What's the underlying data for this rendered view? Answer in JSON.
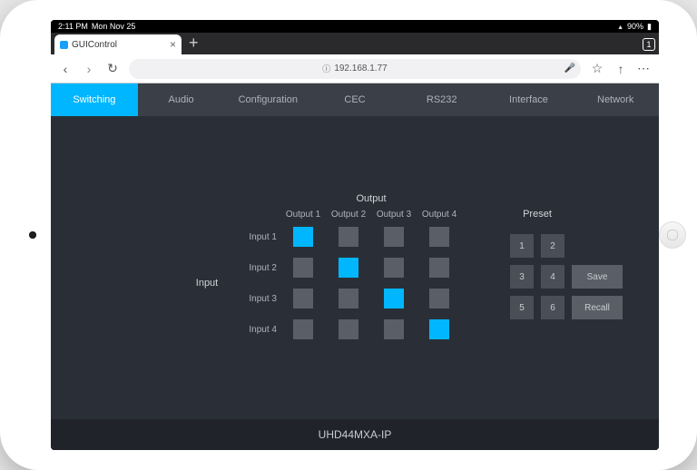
{
  "status": {
    "time": "2:11 PM",
    "date": "Mon Nov 25",
    "battery": "90%"
  },
  "browser": {
    "tab_title": "GUIControl",
    "tab_count": "1",
    "url": "192.168.1.77"
  },
  "nav": {
    "items": [
      "Switching",
      "Audio",
      "Configuration",
      "CEC",
      "RS232",
      "Interface",
      "Network"
    ],
    "active": 0
  },
  "matrix": {
    "output_title": "Output",
    "input_title": "Input",
    "outputs": [
      "Output 1",
      "Output 2",
      "Output 3",
      "Output 4"
    ],
    "inputs": [
      "Input 1",
      "Input 2",
      "Input 3",
      "Input 4"
    ],
    "active": [
      [
        0,
        0
      ],
      [
        1,
        1
      ],
      [
        2,
        2
      ],
      [
        3,
        3
      ]
    ]
  },
  "preset": {
    "title": "Preset",
    "buttons": [
      "1",
      "2",
      "3",
      "4",
      "5",
      "6"
    ],
    "save": "Save",
    "recall": "Recall"
  },
  "footer": {
    "model": "UHD44MXA-IP"
  }
}
